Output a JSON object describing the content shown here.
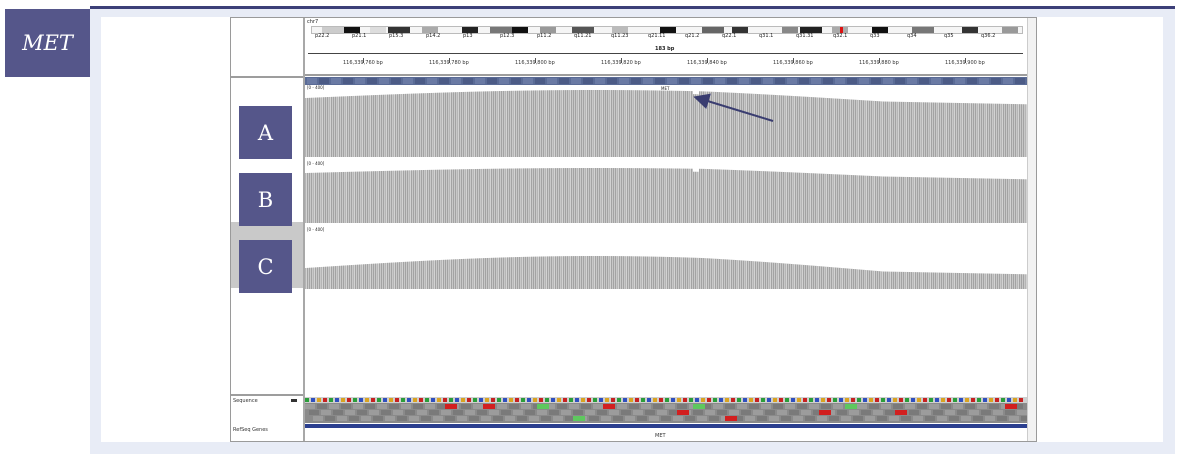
{
  "gene_tag": "MET",
  "sample_labels": [
    "A",
    "B",
    "C"
  ],
  "igv": {
    "chromosome": "chr7",
    "span": "183 bp",
    "cytobands": [
      "p22.2",
      "p21.1",
      "p15.3",
      "p14.2",
      "p13",
      "p12.3",
      "p11.2",
      "q11.21",
      "q11.23",
      "q21.11",
      "q21.2",
      "q22.1",
      "q31.1",
      "q31.31",
      "q32.1",
      "q33",
      "q34",
      "q35",
      "q36.2"
    ],
    "ruler_ticks": [
      "116,339,760 bp",
      "116,339,780 bp",
      "116,339,800 bp",
      "116,339,820 bp",
      "116,339,840 bp",
      "116,339,860 bp",
      "116,339,880 bp",
      "116,339,900 bp"
    ],
    "track_range": "[0 - 400]",
    "gene_name": "MET",
    "left_labels": {
      "sequence": "Sequence",
      "refseq": "RefSeq Genes"
    }
  },
  "colors": {
    "label_bg": "#55568a",
    "coverage": "#a3a3a3",
    "frame": "#e8ecf6",
    "arrow": "#3a3d70"
  }
}
